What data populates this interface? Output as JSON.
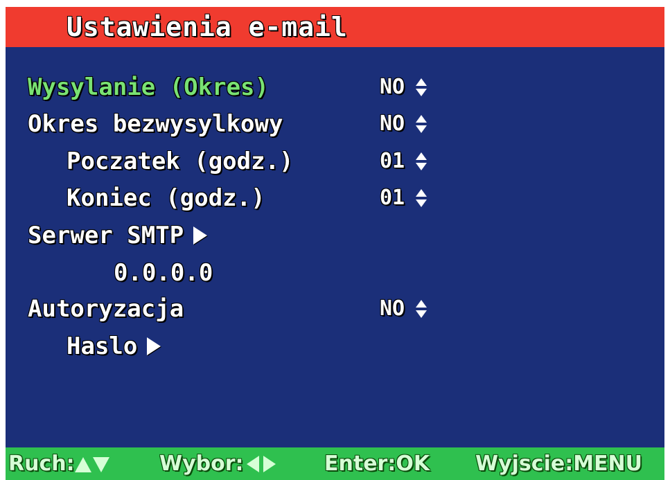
{
  "title": "Ustawienia e-mail",
  "colors": {
    "title_bar": "#f03b2f",
    "panel": "#1b2f79",
    "footer": "#2fc04f",
    "selected_text": "#79e273",
    "text": "#ffffff"
  },
  "menu": {
    "wysylanie": {
      "label": "Wysylanie (Okres)",
      "value": "NO",
      "selected": true
    },
    "okres_bez": {
      "label": "Okres bezwysylkowy",
      "value": "NO"
    },
    "poczatek": {
      "label": "Poczatek (godz.)",
      "value": "01"
    },
    "koniec": {
      "label": "Koniec (godz.)",
      "value": "01"
    },
    "smtp": {
      "label": "Serwer SMTP",
      "address": "0.0.0.0"
    },
    "autoryzacja": {
      "label": "Autoryzacja",
      "value": "NO"
    },
    "haslo": {
      "label": "Haslo"
    }
  },
  "footer": {
    "move_label": "Ruch:",
    "select_label": "Wybor:",
    "enter_label": "Enter:OK",
    "exit_label": "Wyjscie:MENU"
  },
  "icons": {
    "value_adjust": "up-down-arrows-icon",
    "submenu": "right-arrow-icon"
  }
}
